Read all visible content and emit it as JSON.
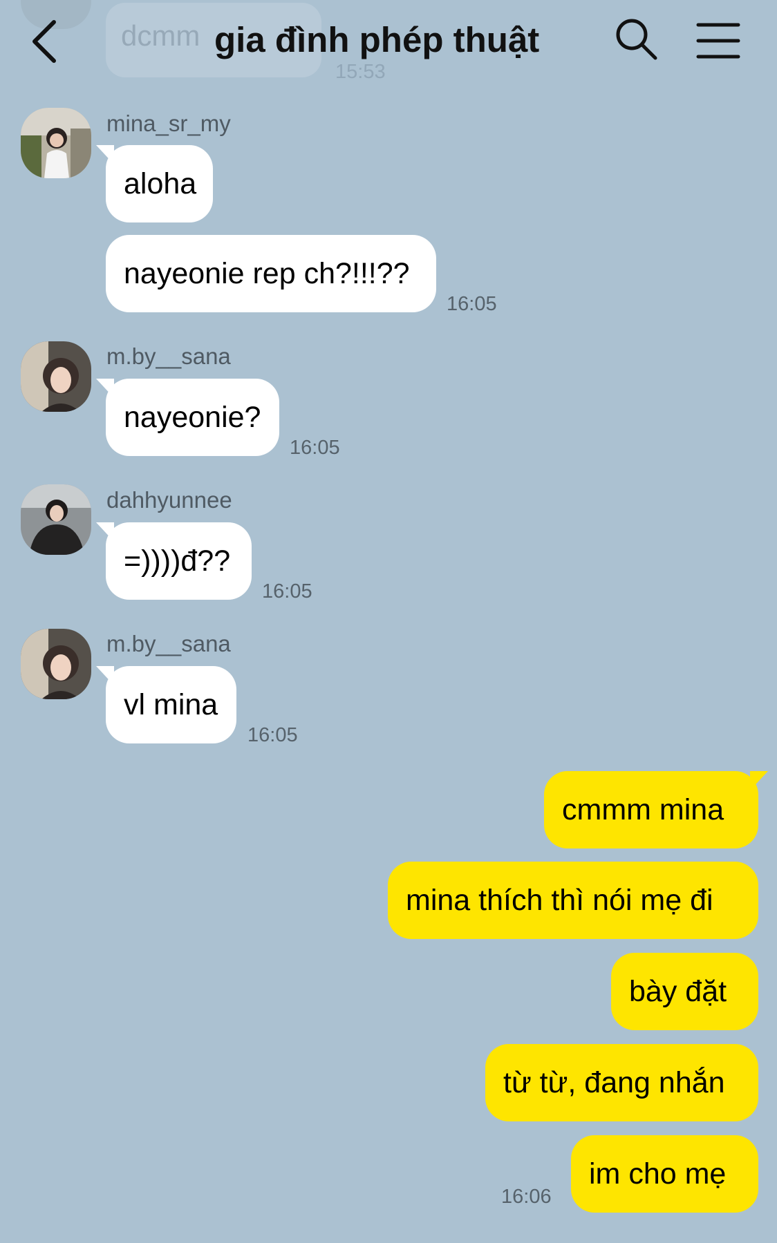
{
  "header": {
    "title": "gia đình phép thuật",
    "previous_message_preview": "dcmm",
    "previous_message_time": "15:53"
  },
  "messages": [
    {
      "sender": "mina_sr_my",
      "text": "aloha"
    },
    {
      "text": "nayeonie rep ch?!!!??",
      "time": "16:05"
    },
    {
      "sender": "m.by__sana",
      "text": "nayeonie?",
      "time": "16:05"
    },
    {
      "sender": "dahhyunnee",
      "text": "=))))đ??",
      "time": "16:05"
    },
    {
      "sender": "m.by__sana",
      "text": "vl mina",
      "time": "16:05"
    },
    {
      "text": "cmmm mina",
      "mine": true
    },
    {
      "text": "mina thích thì nói mẹ đi",
      "mine": true
    },
    {
      "text": "bày đặt",
      "mine": true
    },
    {
      "text": "từ từ, đang nhắn",
      "mine": true
    },
    {
      "text": "im cho mẹ",
      "mine": true,
      "time": "16:06"
    }
  ],
  "icons": {
    "back": "chevron-left-icon",
    "search": "search-icon",
    "menu": "hamburger-menu-icon"
  },
  "colors": {
    "background": "#abc1d1",
    "incoming_bubble": "#ffffff",
    "outgoing_bubble": "#fee500",
    "timestamp": "#56626b",
    "sender_name": "#4f5a63"
  }
}
